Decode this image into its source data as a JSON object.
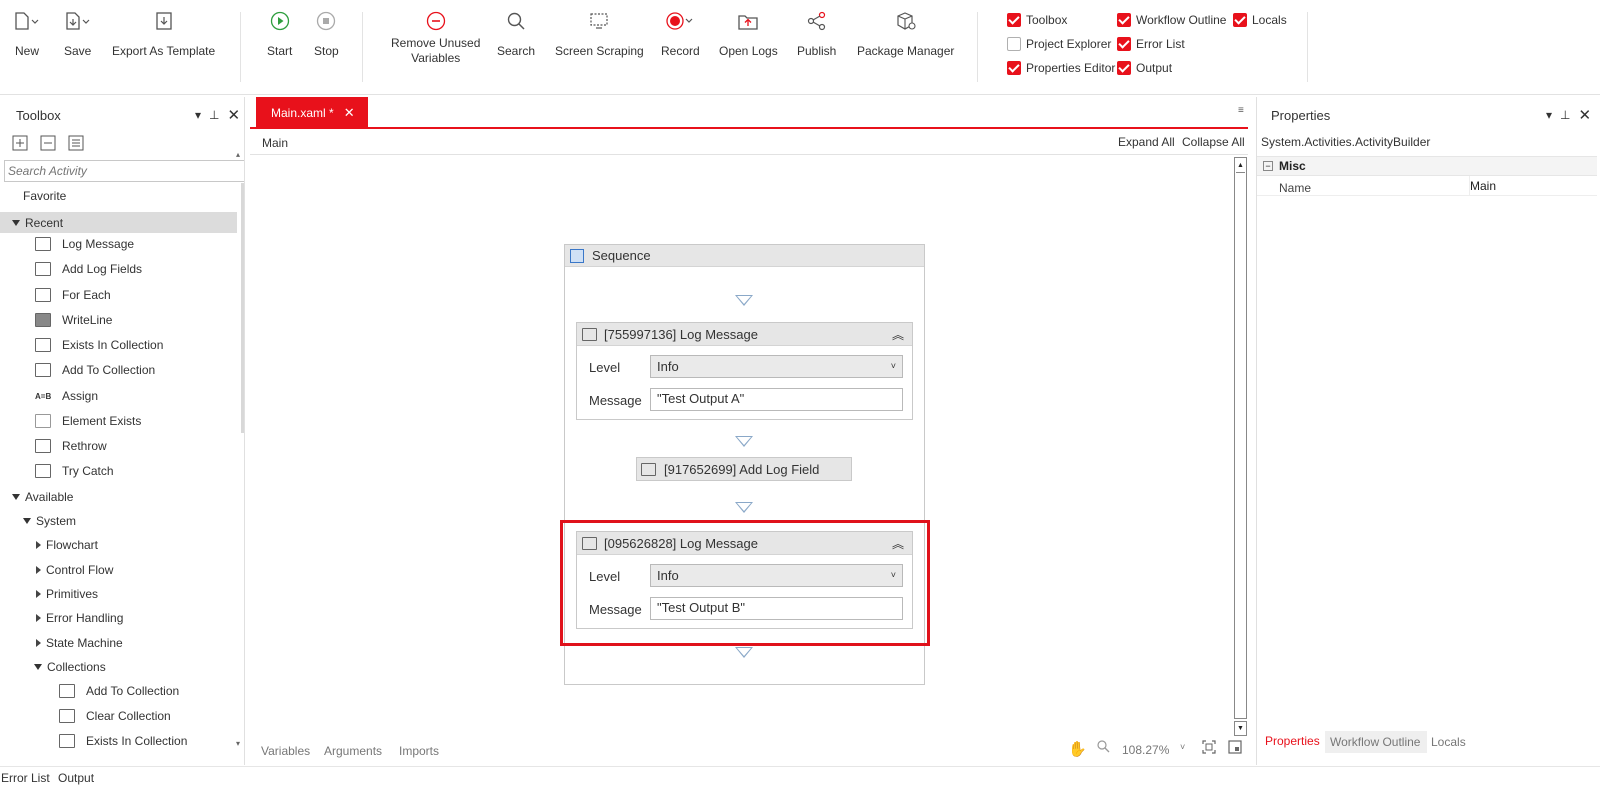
{
  "ribbon": {
    "new": "New",
    "save": "Save",
    "export_template": "Export As Template",
    "start": "Start",
    "stop": "Stop",
    "remove_unused_1": "Remove Unused",
    "remove_unused_2": "Variables",
    "search": "Search",
    "screen_scraping": "Screen Scraping",
    "record": "Record",
    "open_logs": "Open Logs",
    "publish": "Publish",
    "package_manager": "Package Manager",
    "checks": {
      "toolbox": "Toolbox",
      "workflow_outline": "Workflow Outline",
      "locals": "Locals",
      "project_explorer": "Project Explorer",
      "error_list": "Error List",
      "properties_editor": "Properties Editor",
      "output": "Output"
    },
    "check_states": {
      "toolbox": true,
      "workflow_outline": true,
      "locals": true,
      "project_explorer": false,
      "error_list": true,
      "properties_editor": true,
      "output": true
    }
  },
  "toolbox": {
    "title": "Toolbox",
    "search_placeholder": "Search Activity",
    "favorite": "Favorite",
    "recent": "Recent",
    "recent_items": [
      "Log Message",
      "Add Log Fields",
      "For Each",
      "WriteLine",
      "Exists In Collection",
      "Add To Collection",
      "Assign",
      "Element Exists",
      "Rethrow",
      "Try Catch"
    ],
    "available": "Available",
    "system": "System",
    "system_groups": [
      "Flowchart",
      "Control Flow",
      "Primitives",
      "Error Handling",
      "State Machine"
    ],
    "collections": "Collections",
    "collection_items": [
      "Add To Collection",
      "Clear Collection",
      "Exists In Collection"
    ]
  },
  "designer": {
    "tab_label": "Main.xaml *",
    "breadcrumb": "Main",
    "expand_all": "Expand All",
    "collapse_all": "Collapse All",
    "sequence_title": "Sequence",
    "log1": {
      "title": "[755997136] Log Message",
      "level_label": "Level",
      "level_value": "Info",
      "message_label": "Message",
      "message_value": "\"Test Output A\""
    },
    "add_log_field": "[917652699] Add Log Field",
    "log2": {
      "title": "[095626828] Log Message",
      "level_label": "Level",
      "level_value": "Info",
      "message_label": "Message",
      "message_value": "\"Test Output B\""
    },
    "bottom_tabs": [
      "Variables",
      "Arguments",
      "Imports"
    ],
    "zoom": "108.27%"
  },
  "properties": {
    "title": "Properties",
    "type_name": "System.Activities.ActivityBuilder",
    "category": "Misc",
    "name_label": "Name",
    "name_value": "Main",
    "bottom_tabs": [
      "Properties",
      "Workflow Outline",
      "Locals"
    ]
  },
  "statusbar": {
    "tabs": [
      "Error List",
      "Output"
    ]
  },
  "colors": {
    "accent": "#e8111b",
    "highlight_border": "#e0111b",
    "arrow": "#8aa8c8"
  }
}
